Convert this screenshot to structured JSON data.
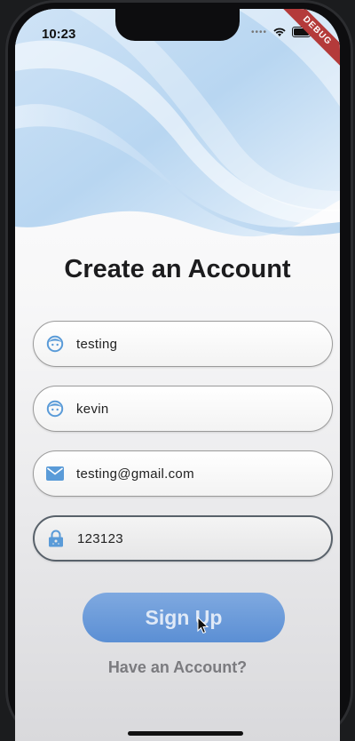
{
  "status_bar": {
    "time": "10:23",
    "signal_icon": "signal-dots-icon",
    "wifi_icon": "wifi-icon",
    "battery_icon": "battery-icon",
    "debug_label": "DEBUG"
  },
  "page": {
    "title": "Create an Account"
  },
  "form": {
    "fields": [
      {
        "name": "first-name",
        "icon": "face-icon",
        "value": "testing"
      },
      {
        "name": "last-name",
        "icon": "face-icon",
        "value": "kevin"
      },
      {
        "name": "email",
        "icon": "mail-icon",
        "value": "testing@gmail.com"
      },
      {
        "name": "password",
        "icon": "lock-icon",
        "value": "123123"
      }
    ],
    "signup_label": "Sign Up",
    "have_account_label": "Have an Account?"
  },
  "colors": {
    "accent": "#5b8fd4",
    "icon_blue": "#5a9bd8",
    "wave_light": "#dcebf8",
    "wave_mid": "#a9cdee"
  }
}
